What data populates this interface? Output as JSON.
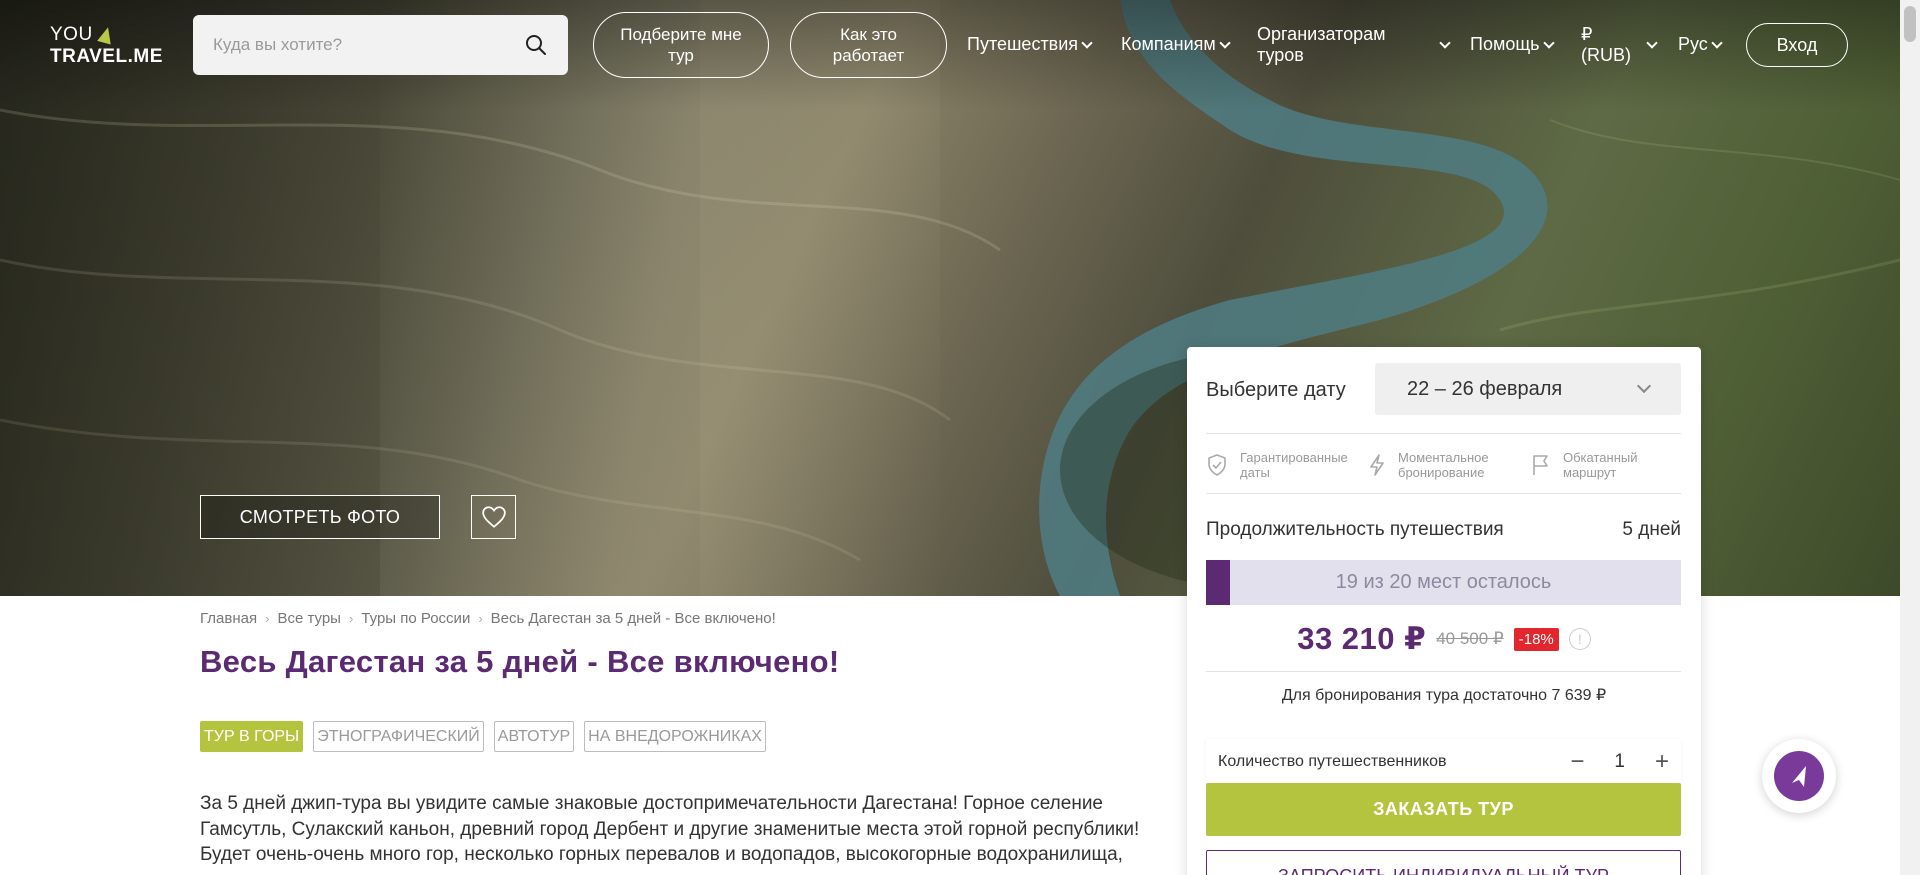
{
  "header": {
    "logo_line1": "YOU",
    "logo_line2": "TRAVEL.ME",
    "search_placeholder": "Куда вы хотите?",
    "pick_tour_label": "Подберите мне тур",
    "how_it_works_label": "Как это работает",
    "nav": {
      "travel": "Путешествия",
      "companies": "Компаниям",
      "organizers": "Организаторам туров",
      "help": "Помощь",
      "currency": "₽ (RUB)",
      "language": "Рус"
    },
    "login_label": "Вход"
  },
  "hero": {
    "photo_button": "СМОТРЕТЬ ФОТО"
  },
  "breadcrumbs": [
    "Главная",
    "Все туры",
    "Туры по России",
    "Весь Дагестан за 5 дней - Все включено!"
  ],
  "page_title": "Весь Дагестан за 5 дней - Все включено!",
  "tags": [
    "ТУР В ГОРЫ",
    "ЭТНОГРАФИЧЕСКИЙ",
    "АВТОТУР",
    "НА ВНЕДОРОЖНИКАХ"
  ],
  "description": "За 5 дней джип-тура вы увидите самые знаковые достопримечательности Дагестана! Горное селение Гамсутль, Сулакский каньон, древний город Дербент и другие знаменитые места этой горной республики!  Будет очень-очень много гор, несколько горных перевалов и водопадов, высокогорные водохранилища, проживание в этнодомах в горах, вкусная национальная еда и...",
  "booking": {
    "choose_date_label": "Выберите дату",
    "selected_date": "22 – 26 февраля",
    "features": [
      {
        "icon": "shield-icon",
        "text": "Гарантированные даты"
      },
      {
        "icon": "lightning-icon",
        "text": "Моментальное бронирование"
      },
      {
        "icon": "flag-icon",
        "text": "Обкатанный маршрут"
      }
    ],
    "duration_label": "Продолжительность путешествия",
    "duration_value": "5 дней",
    "seats_text": "19 из 20 мест осталось",
    "seats_taken_fraction": 0.05,
    "price": "33 210 ₽",
    "old_price": "40 500 ₽",
    "discount": "-18%",
    "info_glyph": "!",
    "deposit_text": "Для бронирования тура достаточно 7 639 ₽",
    "travelers_label": "Количество путешественников",
    "travelers_count": "1",
    "minus_glyph": "−",
    "plus_glyph": "+",
    "order_button": "ЗАКАЗАТЬ ТУР",
    "individual_button": "ЗАПРОСИТЬ ИНДИВИДУАЛЬНЫЙ ТУР"
  },
  "colors": {
    "brand_purple": "#5c2a72",
    "accent_green": "#b4c43f",
    "discount_red": "#e3262e"
  }
}
